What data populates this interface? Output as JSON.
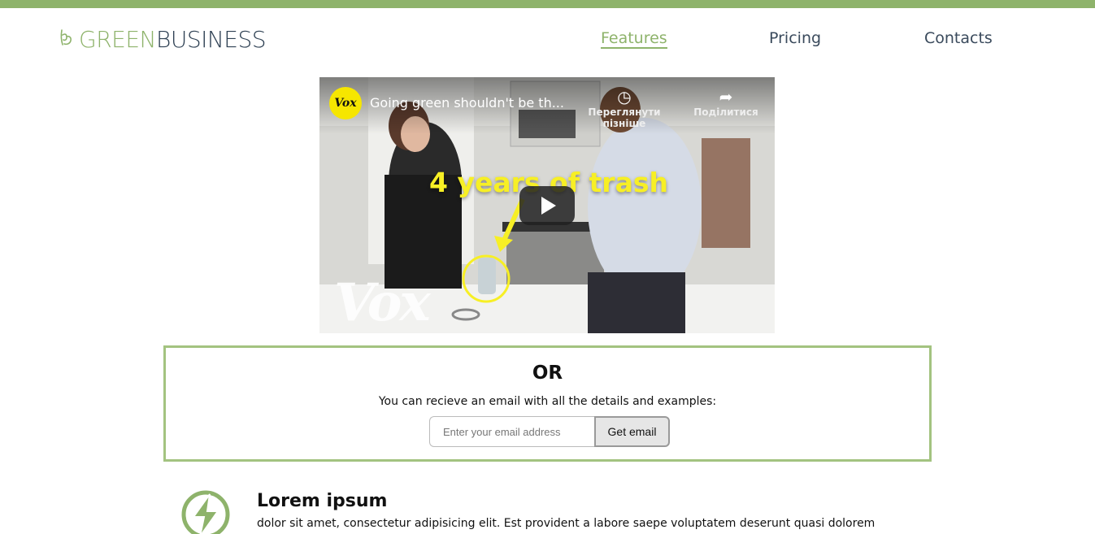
{
  "brand": {
    "part1": "GREEN",
    "part2": "BUSINESS"
  },
  "nav": {
    "features": "Features",
    "pricing": "Pricing",
    "contacts": "Contacts"
  },
  "video": {
    "channel_logo": "Vox",
    "title": "Going green shouldn't be th...",
    "watch_later": "Переглянути пізніше",
    "share": "Поділитися",
    "overlay_text": "4 years of trash",
    "watermark": "Vox"
  },
  "signup": {
    "heading": "OR",
    "description": "You can recieve an email with all the details and examples:",
    "email_placeholder": "Enter your email address",
    "button_label": "Get email"
  },
  "feature": {
    "icon": "lightning-icon",
    "title": "Lorem ipsum",
    "text": "dolor sit amet, consectetur adipisicing elit. Est provident a labore saepe voluptatem deserunt quasi dolorem sint facilis."
  },
  "colors": {
    "accent": "#8eb36b",
    "brand_dark": "#2e4053",
    "border": "#a3c380"
  }
}
